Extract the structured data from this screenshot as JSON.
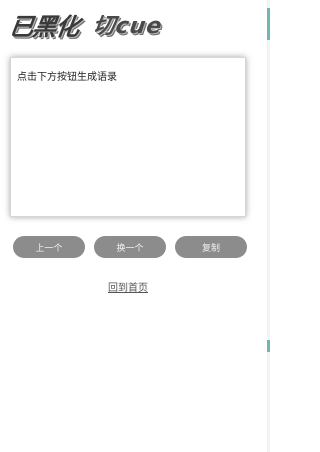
{
  "logo": {
    "part1": "已黑化",
    "part2": "切cue"
  },
  "quote": {
    "text": "点击下方按钮生成语录"
  },
  "buttons": {
    "prev": "上一个",
    "change": "换一个",
    "copy": "复制"
  },
  "links": {
    "home": "回到首页"
  },
  "colors": {
    "button_bg": "#8c8c8c",
    "scroll_accent": "#6fb7b2"
  }
}
